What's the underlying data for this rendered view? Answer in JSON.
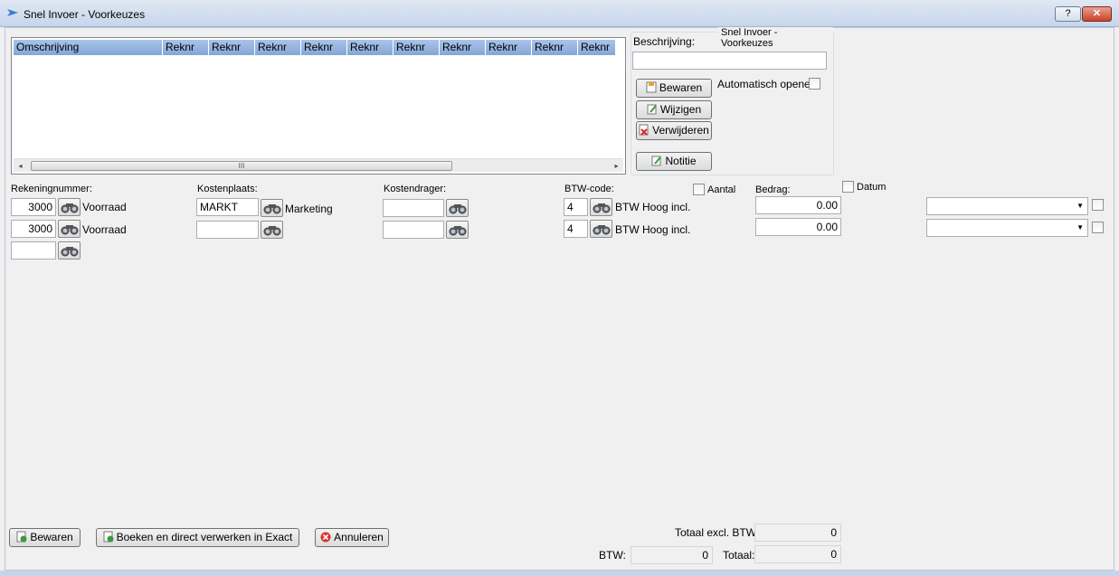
{
  "window": {
    "title": "Snel Invoer - Voorkeuzes",
    "help_label": "?",
    "close_label": "✕"
  },
  "list": {
    "columns": [
      "Omschrijving",
      "Reknr",
      "Reknr",
      "Reknr",
      "Reknr",
      "Reknr",
      "Reknr",
      "Reknr",
      "Reknr",
      "Reknr",
      "Reknr"
    ],
    "scroll_left": "◂",
    "scroll_right": "▸",
    "thumb_grip": "III"
  },
  "preferences": {
    "group_title": "Snel Invoer - Voorkeuzes",
    "description_label": "Beschrijving:",
    "description_value": "",
    "save_label": "Bewaren",
    "edit_label": "Wijzigen",
    "delete_label": "Verwijderen",
    "note_label": "Notitie",
    "auto_open_label": "Automatisch openen"
  },
  "columns": {
    "rekeningnummer": "Rekeningnummer:",
    "kostenplaats": "Kostenplaats:",
    "kostendrager": "Kostendrager:",
    "btw_code": "BTW-code:",
    "aantal": "Aantal",
    "bedrag": "Bedrag:",
    "datum": "Datum"
  },
  "rows": [
    {
      "account": "3000",
      "account_name": "Voorraad",
      "costcenter": "MARKT",
      "costcenter_name": "Marketing",
      "costunit": "",
      "vat_code": "4",
      "vat_name": "BTW Hoog incl.",
      "amount": "0.00",
      "date": ""
    },
    {
      "account": "3000",
      "account_name": "Voorraad",
      "costcenter": "",
      "costcenter_name": "",
      "costunit": "",
      "vat_code": "4",
      "vat_name": "BTW Hoog incl.",
      "amount": "0.00",
      "date": ""
    },
    {
      "account": "",
      "account_name": ""
    }
  ],
  "footer": {
    "save_label": "Bewaren",
    "book_label": "Boeken en direct verwerken in Exact",
    "cancel_label": "Annuleren",
    "total_excl_label": "Totaal excl. BTW:",
    "total_excl_value": "0",
    "vat_label": "BTW:",
    "vat_value": "0",
    "total_label": "Totaal:",
    "total_value": "0"
  }
}
